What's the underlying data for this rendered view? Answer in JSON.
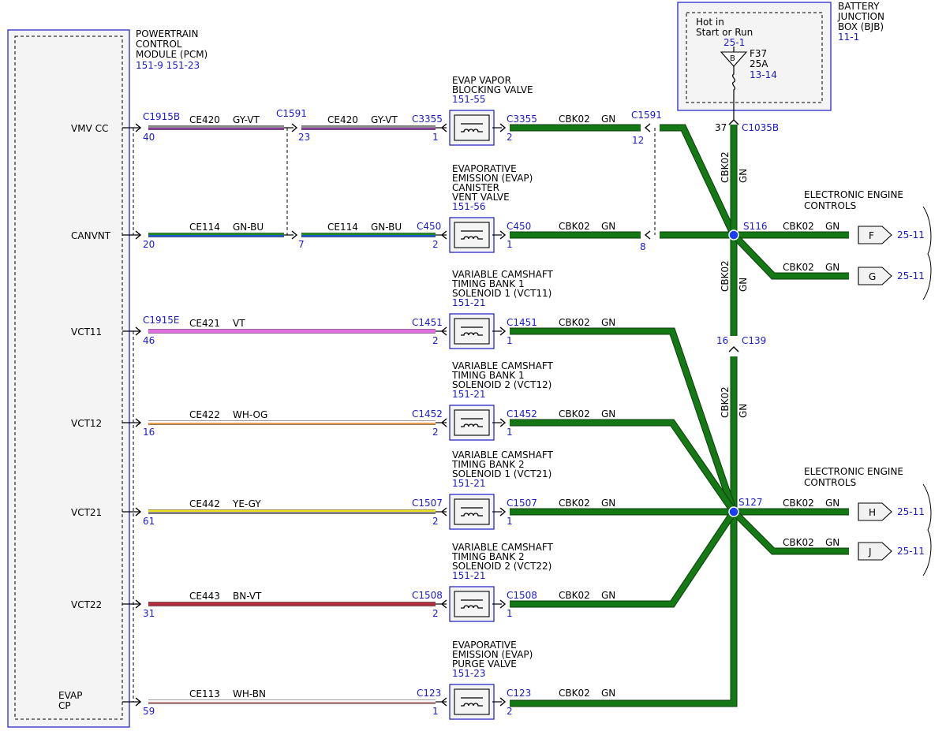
{
  "pcm": {
    "title_lines": [
      "POWERTRAIN",
      "CONTROL",
      "MODULE (PCM)"
    ],
    "refs": "151-9  151-23"
  },
  "bjb": {
    "title_lines": [
      "BATTERY",
      "JUNCTION",
      "BOX (BJB)"
    ],
    "ref": "11-1",
    "hot_lines": [
      "Hot in",
      "Start or Run"
    ],
    "hot_ref": "25-1",
    "fuse_pin": "B",
    "fuse_name": "F37",
    "fuse_rating": "25A",
    "fuse_ref": "13-14",
    "out_pin": "37",
    "out_conn": "C1035B"
  },
  "circuits": [
    {
      "signal": "VMV CC",
      "pcm_conn": "C1915B",
      "pcm_pin": "40",
      "mid": {
        "conn": "C1591",
        "pin": "23"
      },
      "wire1": {
        "circuit": "CE420",
        "color": "GY-VT",
        "c1": "#8c8c8c",
        "c2": "#8a3d9c"
      },
      "wire2": {
        "circuit": "CE420",
        "color": "GY-VT"
      },
      "comp_lines": [
        "EVAP VAPOR",
        "BLOCKING VALVE"
      ],
      "comp_ref": "151-55",
      "comp_conn_left": "C3355",
      "comp_pin_left": "1",
      "comp_conn_right": "C3355",
      "comp_pin_right": "2",
      "gn_circuit": "CBK02",
      "gn_color": "GN",
      "right": {
        "conn": "C1591",
        "pin": "12"
      }
    },
    {
      "signal": "CANVNT",
      "pcm_conn": "",
      "pcm_pin": "20",
      "mid": {
        "conn": "",
        "pin": "7"
      },
      "wire1": {
        "circuit": "CE114",
        "color": "GN-BU",
        "c1": "#1e8a1e",
        "c2": "#2255cc"
      },
      "wire2": {
        "circuit": "CE114",
        "color": "GN-BU"
      },
      "comp_lines": [
        "EVAPORATIVE",
        "EMISSION (EVAP)",
        "CANISTER",
        "VENT VALVE"
      ],
      "comp_ref": "151-56",
      "comp_conn_left": "C450",
      "comp_pin_left": "2",
      "comp_conn_right": "C450",
      "comp_pin_right": "1",
      "gn_circuit": "CBK02",
      "gn_color": "GN",
      "right": {
        "conn": "",
        "pin": "8"
      }
    },
    {
      "signal": "VCT11",
      "pcm_conn": "C1915E",
      "pcm_pin": "46",
      "wire1": {
        "circuit": "CE421",
        "color": "VT",
        "c1": "#e070e0",
        "c2": "#e070e0"
      },
      "comp_lines": [
        "VARIABLE CAMSHAFT",
        "TIMING BANK 1",
        "SOLENOID 1 (VCT11)"
      ],
      "comp_ref": "151-21",
      "comp_conn_left": "C1451",
      "comp_pin_left": "2",
      "comp_conn_right": "C1451",
      "comp_pin_right": "1",
      "gn_circuit": "CBK02",
      "gn_color": "GN"
    },
    {
      "signal": "VCT12",
      "pcm_conn": "",
      "pcm_pin": "16",
      "wire1": {
        "circuit": "CE422",
        "color": "WH-OG",
        "c1": "#ffffff",
        "c2": "#e8a050"
      },
      "comp_lines": [
        "VARIABLE CAMSHAFT",
        "TIMING BANK 1",
        "SOLENOID 2 (VCT12)"
      ],
      "comp_ref": "151-21",
      "comp_conn_left": "C1452",
      "comp_pin_left": "2",
      "comp_conn_right": "C1452",
      "comp_pin_right": "1",
      "gn_circuit": "CBK02",
      "gn_color": "GN"
    },
    {
      "signal": "VCT21",
      "pcm_conn": "",
      "pcm_pin": "61",
      "wire1": {
        "circuit": "CE442",
        "color": "YE-GY",
        "c1": "#f0e020",
        "c2": "#8c8c8c"
      },
      "comp_lines": [
        "VARIABLE CAMSHAFT",
        "TIMING BANK 2",
        "SOLENOID 1 (VCT21)"
      ],
      "comp_ref": "151-21",
      "comp_conn_left": "C1507",
      "comp_pin_left": "2",
      "comp_conn_right": "C1507",
      "comp_pin_right": "1",
      "gn_circuit": "CBK02",
      "gn_color": "GN"
    },
    {
      "signal": "VCT22",
      "pcm_conn": "",
      "pcm_pin": "31",
      "wire1": {
        "circuit": "CE443",
        "color": "BN-VT",
        "c1": "#b03040",
        "c2": "#b03040"
      },
      "comp_lines": [
        "VARIABLE CAMSHAFT",
        "TIMING BANK 2",
        "SOLENOID 2 (VCT22)"
      ],
      "comp_ref": "151-21",
      "comp_conn_left": "C1508",
      "comp_pin_left": "2",
      "comp_conn_right": "C1508",
      "comp_pin_right": "1",
      "gn_circuit": "CBK02",
      "gn_color": "GN"
    },
    {
      "signal": "EVAP\nCP",
      "pcm_conn": "",
      "pcm_pin": "59",
      "wire1": {
        "circuit": "CE113",
        "color": "WH-BN",
        "c1": "#ffffff",
        "c2": "#c89090"
      },
      "comp_lines": [
        "EVAPORATIVE",
        "EMISSION (EVAP)",
        "PURGE VALVE"
      ],
      "comp_ref": "151-23",
      "comp_conn_left": "C123",
      "comp_pin_left": "1",
      "comp_conn_right": "C123",
      "comp_pin_right": "2",
      "gn_circuit": "CBK02",
      "gn_color": "GN"
    }
  ],
  "trunk": {
    "upper_label": [
      "CBK02",
      "GN"
    ],
    "mid_label": [
      "CBK02",
      "GN"
    ],
    "lower_label": [
      "CBK02",
      "GN"
    ],
    "c139_pin": "16",
    "c139_conn": "C139"
  },
  "splices": {
    "s116": "S116",
    "s127": "S127"
  },
  "outputs": {
    "top_title": [
      "ELECTRONIC ENGINE",
      "CONTROLS"
    ],
    "bottom_title": [
      "ELECTRONIC ENGINE",
      "CONTROLS"
    ],
    "list": [
      {
        "letter": "F",
        "circuit": "CBK02",
        "color": "GN",
        "ref": "25-11"
      },
      {
        "letter": "G",
        "circuit": "CBK02",
        "color": "GN",
        "ref": "25-11"
      },
      {
        "letter": "H",
        "circuit": "CBK02",
        "color": "GN",
        "ref": "25-11"
      },
      {
        "letter": "J",
        "circuit": "CBK02",
        "color": "GN",
        "ref": "25-11"
      }
    ]
  },
  "colors": {
    "ref_blue": "#1a1acc",
    "gn_wire": "#147814",
    "box_blue": "#2a2acc"
  }
}
